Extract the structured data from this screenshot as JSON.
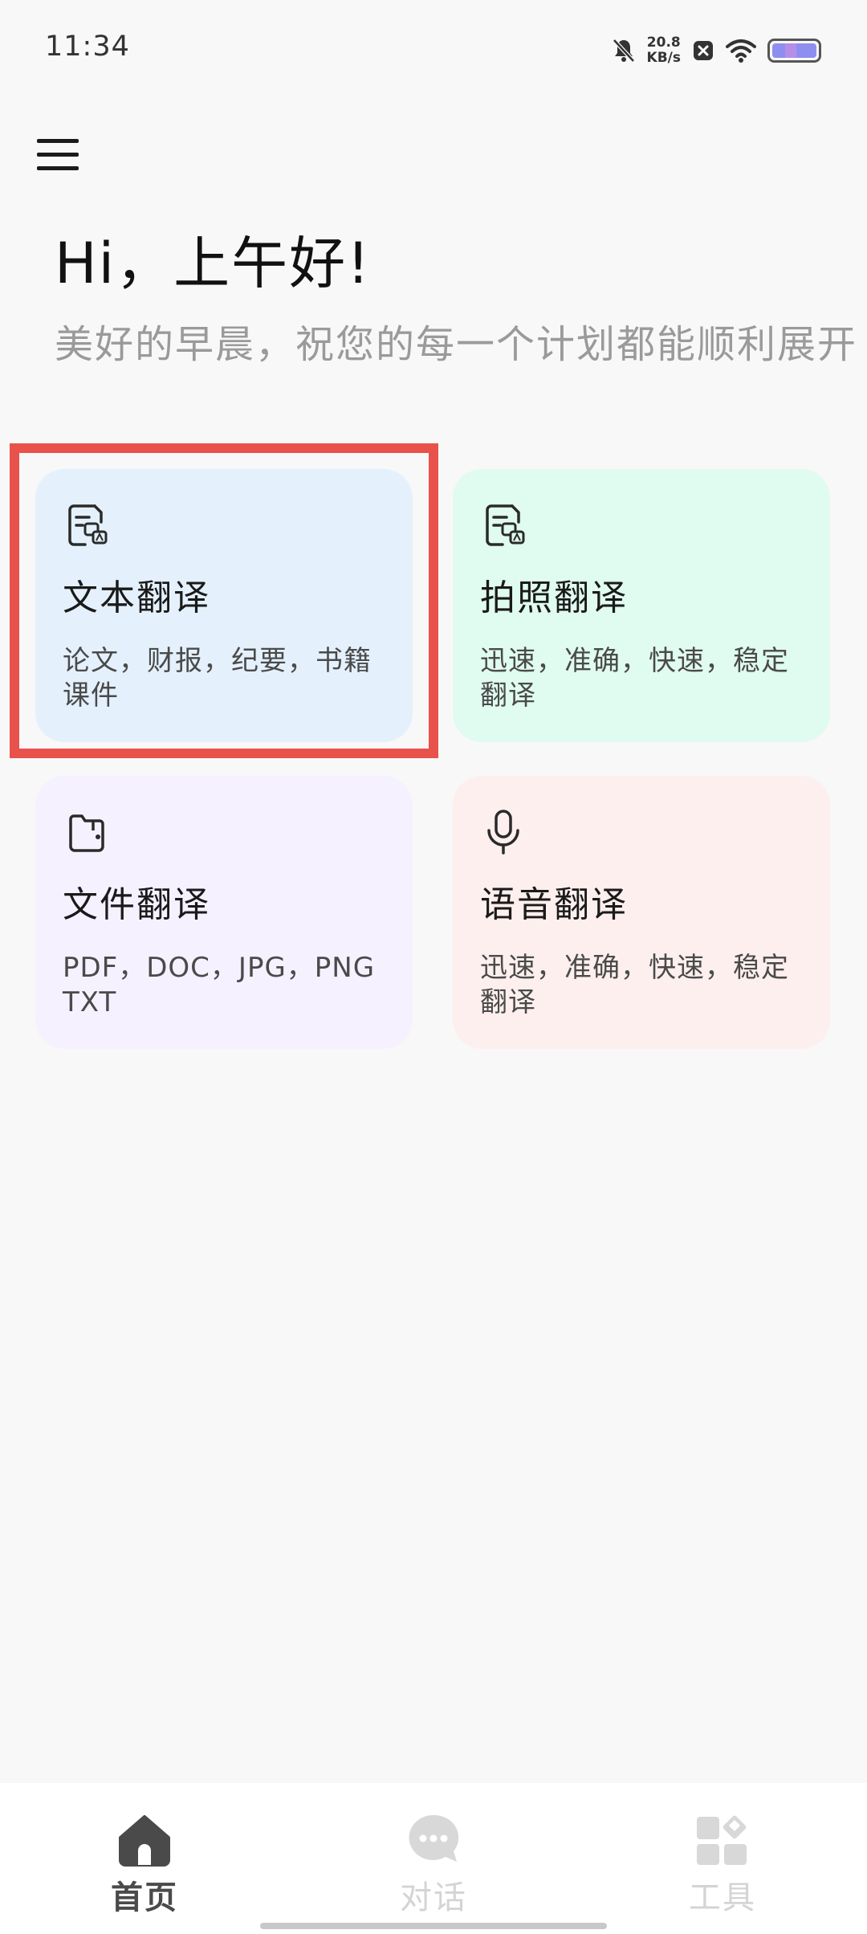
{
  "status_bar": {
    "time": "11:34",
    "net_speed_value": "20.8",
    "net_speed_unit": "KB/s",
    "icons": [
      "bell-muted-icon",
      "close-box-icon",
      "wifi-icon",
      "battery-icon"
    ]
  },
  "header": {
    "menu_icon": "menu-icon",
    "greeting": "Hi，上午好!",
    "subtitle": "美好的早晨，祝您的每一个计划都能顺利展开"
  },
  "cards": [
    {
      "title": "文本翻译",
      "desc": "论文，财报，纪要，书籍 课件",
      "icon": "document-translate-icon",
      "bg": "#e4f1fd",
      "highlighted": true
    },
    {
      "title": "拍照翻译",
      "desc": "迅速，准确，快速，稳定 翻译",
      "icon": "document-translate-icon",
      "bg": "#e0fbef",
      "highlighted": false
    },
    {
      "title": "文件翻译",
      "desc": "PDF，DOC，JPG，PNG TXT",
      "icon": "folder-icon",
      "bg": "#f6f1ff",
      "highlighted": false
    },
    {
      "title": "语音翻译",
      "desc": "迅速，准确，快速，稳定 翻译",
      "icon": "microphone-icon",
      "bg": "#fdefee",
      "highlighted": false
    }
  ],
  "bottom_nav": {
    "items": [
      {
        "label": "首页",
        "icon": "home-icon",
        "active": true
      },
      {
        "label": "对话",
        "icon": "chat-bubble-icon",
        "active": false
      },
      {
        "label": "工具",
        "icon": "tools-grid-icon",
        "active": false
      }
    ]
  },
  "colors": {
    "highlight_border": "#e8524a",
    "nav_active": "#4a4a4a",
    "nav_inactive": "#d4d4d4"
  }
}
